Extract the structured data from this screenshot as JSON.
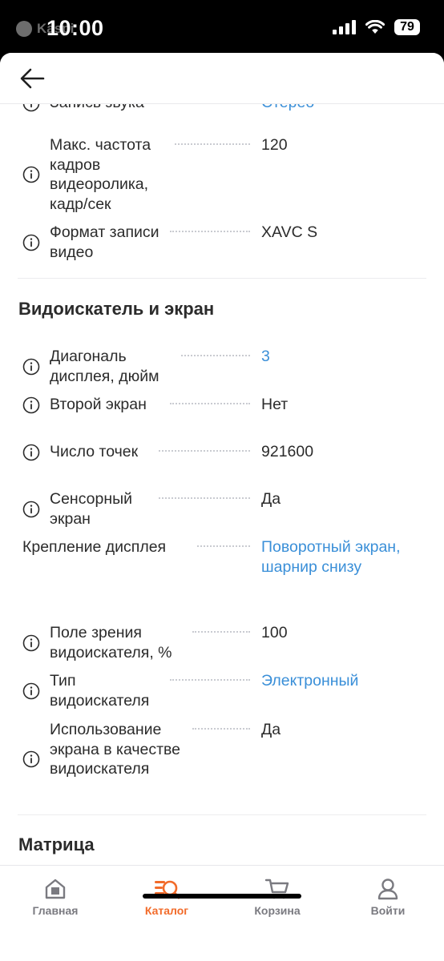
{
  "status_bar": {
    "time": "10:00",
    "battery": "79",
    "watermark": "Kaspi"
  },
  "sections": [
    {
      "rows": [
        {
          "label": "Запись звука",
          "value": "Стерео",
          "link": true
        },
        {
          "label": "Макс. частота кадров видеоролика, кадр/сек",
          "value": "120",
          "link": false
        },
        {
          "label": "Формат записи видео",
          "value": "XAVC S",
          "link": false
        }
      ]
    },
    {
      "title": "Видоискатель и экран",
      "rows": [
        {
          "label": "Диагональ дисплея, дюйм",
          "value": "3",
          "link": true
        },
        {
          "label": "Второй экран",
          "value": "Нет",
          "link": false
        },
        {
          "label": "Число точек",
          "value": "921600",
          "link": false
        },
        {
          "label": "Сенсорный экран",
          "value": "Да",
          "link": false
        },
        {
          "label": "Крепление дисплея",
          "value": "Поворотный экран, шарнир снизу",
          "link": true
        },
        {
          "label": "Поле зрения видоискателя, %",
          "value": "100",
          "link": false
        },
        {
          "label": "Тип видоискателя",
          "value": "Электронный",
          "link": true
        },
        {
          "label": "Использование экрана в качестве видоискателя",
          "value": "Да",
          "link": false
        }
      ]
    },
    {
      "title": "Матрица"
    }
  ],
  "tabs": [
    {
      "label": "Главная",
      "icon": "home-icon"
    },
    {
      "label": "Каталог",
      "icon": "catalog-icon",
      "active": true
    },
    {
      "label": "Корзина",
      "icon": "cart-icon"
    },
    {
      "label": "Войти",
      "icon": "user-icon"
    }
  ],
  "colors": {
    "accent": "#f26b2a",
    "link": "#3a8fd8"
  }
}
